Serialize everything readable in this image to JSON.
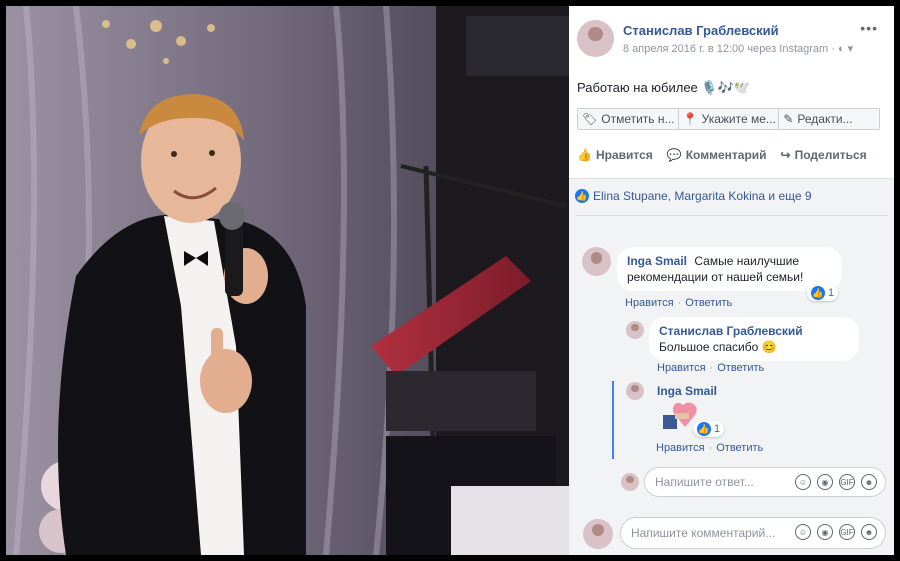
{
  "post": {
    "author": "Станислав Граблевский",
    "meta": "8 апреля 2016 г. в 12:00 через Instagram · ◐ ▾",
    "text": "Работаю на юбилее 🎙️🎶🕊️",
    "more_icon": "more-dots-icon"
  },
  "tag_buttons": [
    {
      "label": "Отметить н...",
      "icon": "tag-icon"
    },
    {
      "label": "Укажите ме...",
      "icon": "location-pin-icon"
    },
    {
      "label": "Редакти...",
      "icon": "pencil-icon"
    }
  ],
  "actions": [
    {
      "label": "Нравится",
      "icon": "like-thumb-icon"
    },
    {
      "label": "Комментарий",
      "icon": "comment-icon"
    },
    {
      "label": "Поделиться",
      "icon": "share-icon"
    }
  ],
  "likes": {
    "text": "Elina Stupane, Margarita Kokina и еще 9"
  },
  "comments": [
    {
      "name": "Inga Smail",
      "text": "Самые наилучшие рекомендации от нашей семьи!",
      "like_label": "Нравится",
      "reply_label": "Ответить",
      "likes_count": "1"
    },
    {
      "name": "Станислав Граблевский",
      "text": "Большое спасибо 😊",
      "like_label": "Нравится",
      "reply_label": "Ответить"
    },
    {
      "name": "Inga Smail",
      "like_label": "Нравится",
      "reply_label": "Ответить",
      "likes_count": "1"
    }
  ],
  "reply_placeholder": "Напишите ответ...",
  "comment_placeholder": "Напишите комментарий...",
  "input_icons": [
    "emoji-icon",
    "camera-icon",
    "gif-icon",
    "sticker-icon"
  ],
  "gif_label": "GIF",
  "colors": {
    "link": "#365899",
    "like_blue": "#1877f2",
    "bg_panel": "#f2f3f5"
  }
}
